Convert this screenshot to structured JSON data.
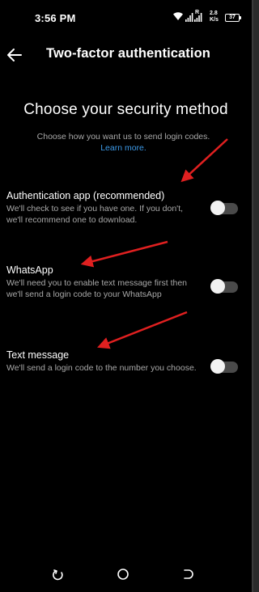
{
  "status_bar": {
    "time": "3:56 PM",
    "network_label": "R",
    "speed_value": "2.8",
    "speed_unit": "K/s",
    "battery": "37"
  },
  "header": {
    "title": "Two-factor authentication"
  },
  "intro": {
    "heading": "Choose your security method",
    "subtitle": "Choose how you want us to send login codes.",
    "learn_more": "Learn more."
  },
  "options": [
    {
      "title": "Authentication app (recommended)",
      "description": "We'll check to see if you have one. If you don't, we'll recommend one to download.",
      "enabled": false
    },
    {
      "title": "WhatsApp",
      "description": "We'll need you to enable text message first then we'll send a login code to your WhatsApp",
      "enabled": false
    },
    {
      "title": "Text message",
      "description": "We'll send a login code to the number you choose.",
      "enabled": false
    }
  ],
  "colors": {
    "background": "#000000",
    "link": "#3d9ae8",
    "annotation_arrow": "#e02020",
    "toggle_track_off": "#4a4a4a"
  },
  "icons": {
    "back": "arrow-left-icon",
    "nav_back": "nav-back-icon",
    "nav_home": "nav-home-icon",
    "nav_recent": "nav-recent-icon"
  }
}
